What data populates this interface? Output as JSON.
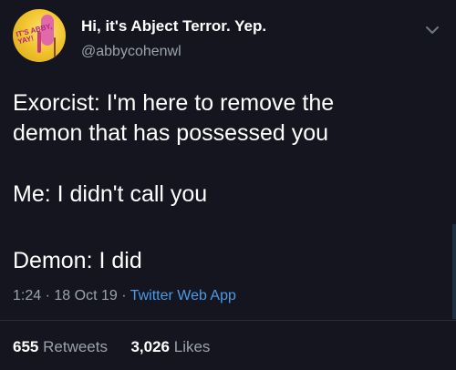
{
  "tweet": {
    "display_name": "Hi, it's Abject Terror. Yep.",
    "handle": "@abbycohenwl",
    "avatar_text": "IT'S ABBY, YAY!",
    "text": {
      "line1": "Exorcist: I'm here to remove the\ndemon that has possessed you",
      "line2": "Me: I didn't call you",
      "line3": "Demon: I did"
    },
    "time": "1:24",
    "date": "18 Oct 19",
    "source": "Twitter Web App",
    "retweets": "655",
    "retweets_label": "Retweets",
    "likes": "3,026",
    "likes_label": "Likes"
  },
  "icons": {
    "menu": "chevron-down-icon"
  },
  "colors": {
    "background": "#151520",
    "muted": "#9aa3ad",
    "link": "#4a9be8"
  }
}
